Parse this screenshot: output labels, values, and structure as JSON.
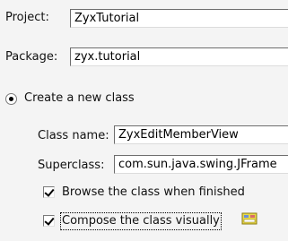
{
  "project": {
    "label": "Project:",
    "value": "ZyxTutorial"
  },
  "package": {
    "label": "Package:",
    "value": "zyx.tutorial"
  },
  "create_new_class": {
    "label": "Create a new class",
    "selected": true
  },
  "class_name": {
    "label": "Class name:",
    "value": "ZyxEditMemberView"
  },
  "superclass": {
    "label": "Superclass:",
    "value": "com.sun.java.swing.JFrame"
  },
  "browse_option": {
    "label": "Browse the class when finished",
    "checked": true
  },
  "compose_option": {
    "label": "Compose the class visually",
    "checked": true
  },
  "icons": {
    "visual_composer": "visual-composer-icon"
  }
}
